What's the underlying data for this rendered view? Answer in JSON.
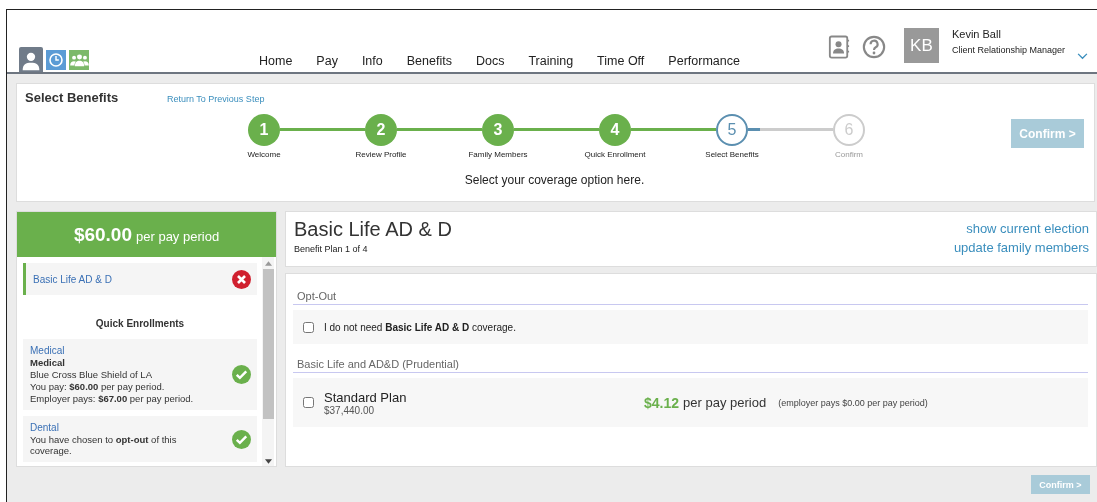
{
  "nav": {
    "items": [
      {
        "label": "Home"
      },
      {
        "label": "Pay"
      },
      {
        "label": "Info"
      },
      {
        "label": "Benefits"
      },
      {
        "label": "Docs"
      },
      {
        "label": "Training"
      },
      {
        "label": "Time Off"
      },
      {
        "label": "Performance"
      }
    ]
  },
  "user": {
    "initials": "KB",
    "name": "Kevin Ball",
    "role": "Client Relationship Manager"
  },
  "wizard": {
    "title": "Select Benefits",
    "back_link": "Return To Previous Step",
    "steps": [
      {
        "number": "1",
        "label": "Welcome",
        "completed": true,
        "current": false
      },
      {
        "number": "2",
        "label": "Review Profile",
        "completed": true,
        "current": false
      },
      {
        "number": "3",
        "label": "Family Members",
        "completed": true,
        "current": false
      },
      {
        "number": "4",
        "label": "Quick Enrollment",
        "completed": true,
        "current": false
      },
      {
        "number": "5",
        "label": "Select Benefits",
        "completed": false,
        "current": true
      },
      {
        "number": "6",
        "label": "Confirm",
        "completed": false,
        "current": false
      }
    ],
    "confirm": {
      "label": "Confirm >",
      "disabled": true
    },
    "hint": "Select your coverage option here."
  },
  "sidebar": {
    "total": "$60.00",
    "total_suffix": "per pay period",
    "items": [
      {
        "title": "Basic Life AD & D",
        "selected": true,
        "complete": false
      }
    ],
    "quick_heading": "Quick Enrollments",
    "quick_enrollments": [
      {
        "title": "Medical",
        "lines": [
          "**Medical**",
          "Blue Cross Blue Shield of LA",
          "You pay: **$60.00** per pay period.",
          "Employer pays: **$67.00** per pay period."
        ],
        "complete": true
      },
      {
        "title": "Dental",
        "lines": [
          "You have chosen to **opt-out** of this coverage."
        ],
        "complete": true
      }
    ]
  },
  "plan": {
    "title": "Basic Life AD & D",
    "subtitle": "Benefit Plan 1 of 4",
    "links": [
      "show current election",
      "update family members"
    ],
    "opt_out": {
      "heading": "Opt-Out",
      "text": "I do not need **Basic Life AD & D** coverage.",
      "checked": false
    },
    "section_heading": "Basic Life and AD&D (Prudential)",
    "options": [
      {
        "name": "Standard Plan",
        "amount": "$37,440.00",
        "price": "$4.12",
        "price_suffix": "per pay period",
        "employer_note": "(employer pays $0.00 per pay period)",
        "checked": false
      }
    ]
  },
  "footer": {
    "confirm": {
      "label": "Confirm >",
      "disabled": true
    }
  }
}
